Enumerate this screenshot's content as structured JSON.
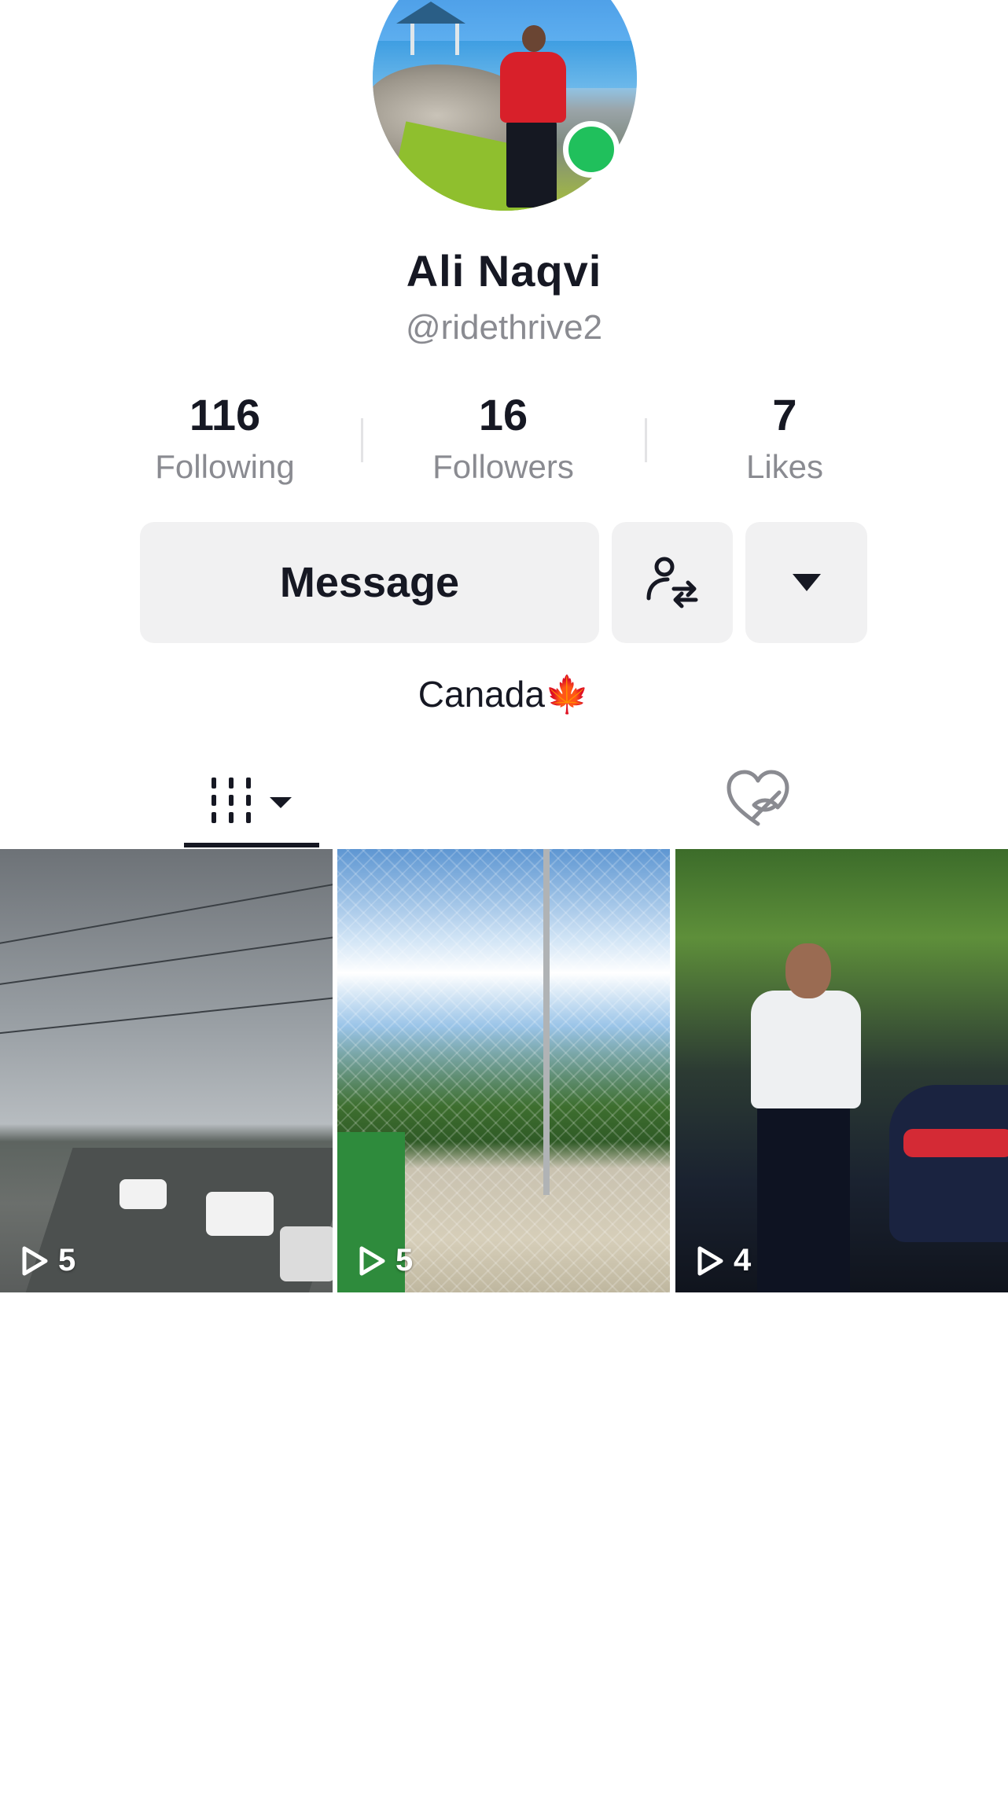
{
  "profile": {
    "display_name": "Ali Naqvi",
    "handle": "@ridethrive2",
    "online_status_color": "#20c05c",
    "bio_text": "Canada",
    "bio_emoji": "🍁"
  },
  "stats": {
    "following": {
      "value": "116",
      "label": "Following"
    },
    "followers": {
      "value": "16",
      "label": "Followers"
    },
    "likes": {
      "value": "7",
      "label": "Likes"
    }
  },
  "actions": {
    "message_label": "Message",
    "follow_switch_icon": "person-swap-icon",
    "more_icon": "caret-down-icon"
  },
  "tabs": [
    {
      "icon": "videos-grid-icon",
      "selected": true
    },
    {
      "icon": "liked-hidden-icon",
      "selected": false
    }
  ],
  "videos": [
    {
      "views": "5",
      "subject": "highway traffic"
    },
    {
      "views": "5",
      "subject": "baseball field"
    },
    {
      "views": "4",
      "subject": "man by car"
    }
  ]
}
